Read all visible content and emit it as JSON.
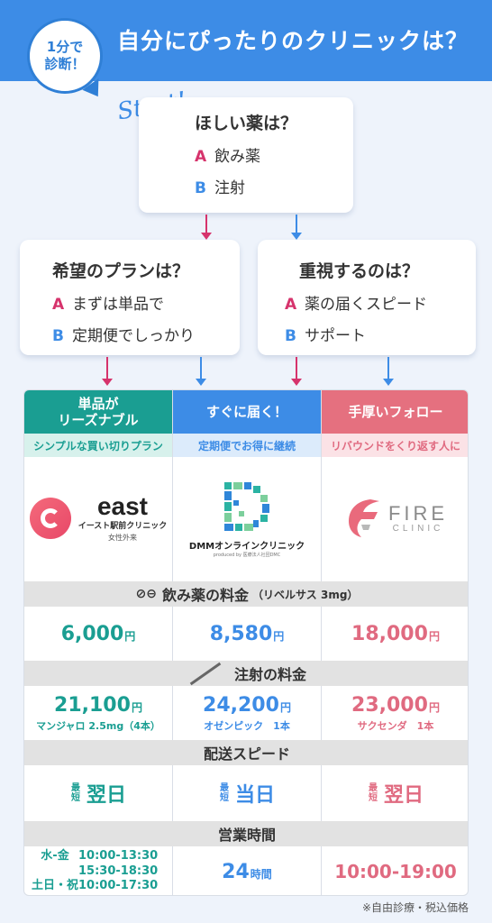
{
  "header": {
    "title": "自分にぴったりのクリニックは？",
    "badge_line1": "1分で",
    "badge_line2": "診断！"
  },
  "flow": {
    "start_label": "Start!",
    "q1": {
      "title": "ほしい薬は？",
      "a": "飲み薬",
      "b": "注射"
    },
    "q2": {
      "title": "希望のプランは？",
      "a": "まずは単品で",
      "b": "定期便でしっかり"
    },
    "q3": {
      "title": "重視するのは？",
      "a": "薬の届くスピード",
      "b": "サポート"
    },
    "letter_a": "A",
    "letter_b": "B"
  },
  "colors": {
    "teal": "#1a9e92",
    "blue": "#3d8ce6",
    "pink": "#e06a80",
    "header": "#3d8ce6"
  },
  "columns": [
    {
      "head": "単品が\nリーズナブル",
      "sub": "シンプルな買い切りプラン"
    },
    {
      "head": "すぐに届く！",
      "sub": "定期便でお得に継続"
    },
    {
      "head": "手厚いフォロー",
      "sub": "リバウンドをくり返す人に"
    }
  ],
  "logos": {
    "east": {
      "word": "east",
      "line1": "イースト駅前クリニック",
      "line2": "女性外来"
    },
    "dmm": {
      "word": "DMMオンラインクリニック",
      "small": "produced by 医療法人社団DMC"
    },
    "fire": {
      "word": "FIRE",
      "sub": "CLINIC"
    }
  },
  "sections": {
    "oral": {
      "label": "飲み薬の料金",
      "note": "（リベルサス 3mg）"
    },
    "injection": {
      "label": "注射の料金"
    },
    "delivery": {
      "label": "配送スピード"
    },
    "hours": {
      "label": "営業時間"
    }
  },
  "oral_prices": [
    {
      "amount": "6,000",
      "unit": "円"
    },
    {
      "amount": "8,580",
      "unit": "円"
    },
    {
      "amount": "18,000",
      "unit": "円"
    }
  ],
  "injection_prices": [
    {
      "amount": "21,100",
      "unit": "円",
      "note": "マンジャロ 2.5mg（4本）"
    },
    {
      "amount": "24,200",
      "unit": "円",
      "note": "オゼンピック　1本"
    },
    {
      "amount": "23,000",
      "unit": "円",
      "note": "サクセンダ　1本"
    }
  ],
  "delivery": [
    {
      "small": "最短",
      "big": "翌日"
    },
    {
      "small": "最短",
      "big": "当日"
    },
    {
      "small": "最短",
      "big": "翌日"
    }
  ],
  "hours": {
    "east": [
      {
        "days": "水-金",
        "time": "10:00-13:30"
      },
      {
        "days": "",
        "time": "15:30-18:30"
      },
      {
        "days": "土日・祝",
        "time": "10:00-17:30"
      }
    ],
    "dmm": {
      "num": "24",
      "unit": "時間"
    },
    "fire": "10:00-19:00"
  },
  "footnote": "※自由診療・税込価格"
}
